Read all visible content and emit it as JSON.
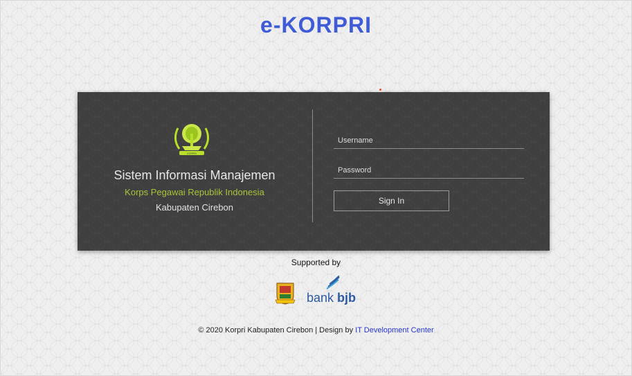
{
  "header": {
    "title": "e-KORPRI"
  },
  "panel": {
    "app_name": "Sistem Informasi Manajemen",
    "org_name": "Korps Pegawai Republik Indonesia",
    "region": "Kabupaten Cirebon",
    "logo_text": "KORPRI"
  },
  "form": {
    "username_placeholder": "Username",
    "username_value": "",
    "password_placeholder": "Password",
    "password_value": "",
    "signin_label": "Sign In"
  },
  "sponsors": {
    "supported_label": "Supported by",
    "bank_text_1": "bank ",
    "bank_text_2": "bjb"
  },
  "footer": {
    "copyright": "© 2020 Korpri Kabupaten Cirebon | Design by ",
    "designer_link": "IT Development Center"
  },
  "colors": {
    "title": "#3f5bd6",
    "panel_bg": "#3f3f3f",
    "accent_green": "#a7c43a",
    "link": "#2736c9",
    "bank_blue": "#2c5aa0"
  },
  "icons": [
    "korpri-logo-icon",
    "cirebon-crest-icon",
    "bank-bjb-logo-icon"
  ]
}
